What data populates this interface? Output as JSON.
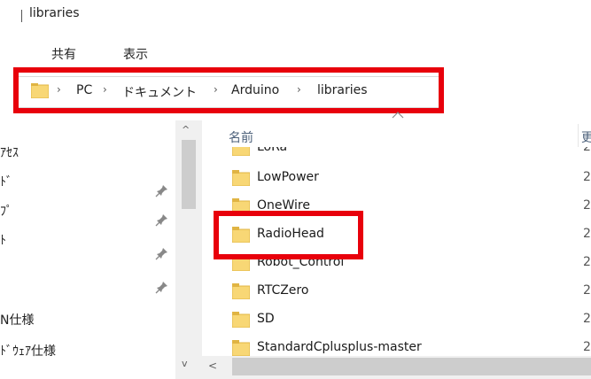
{
  "window": {
    "title": "libraries"
  },
  "ribbon": {
    "tabs": [
      "共有",
      "表示"
    ]
  },
  "address": {
    "crumbs": [
      "PC",
      "ドキュメント",
      "Arduino",
      "libraries"
    ],
    "separator": "›",
    "highlight_color": "#e8000b"
  },
  "nav": {
    "items": [
      {
        "label": "ｱｾｽ",
        "pinned": false
      },
      {
        "label": "ﾄﾞ",
        "pinned": true
      },
      {
        "label": "ﾌﾟ",
        "pinned": true
      },
      {
        "label": "ﾄ",
        "pinned": true
      },
      {
        "label": "",
        "pinned": true
      },
      {
        "label": "N仕様",
        "pinned": false
      },
      {
        "label": "ﾄﾞｳｪｱ仕様",
        "pinned": false
      }
    ],
    "scroll_up": "^",
    "scroll_down": "v"
  },
  "list": {
    "column_name": "名前",
    "column_date": "更",
    "files": [
      {
        "name": "LoRa",
        "date": "2"
      },
      {
        "name": "LowPower",
        "date": "2"
      },
      {
        "name": "OneWire",
        "date": "2"
      },
      {
        "name": "RadioHead",
        "date": "2"
      },
      {
        "name": "Robot_Control",
        "date": "2"
      },
      {
        "name": "RTCZero",
        "date": "2"
      },
      {
        "name": "SD",
        "date": "2"
      },
      {
        "name": "StandardCplusplus-master",
        "date": "2"
      }
    ],
    "highlighted_file": "RadioHead",
    "scroll_left": "<"
  },
  "colors": {
    "folder": "#f8d775",
    "folder_dark": "#e0b443",
    "accent_red": "#e8000b"
  }
}
